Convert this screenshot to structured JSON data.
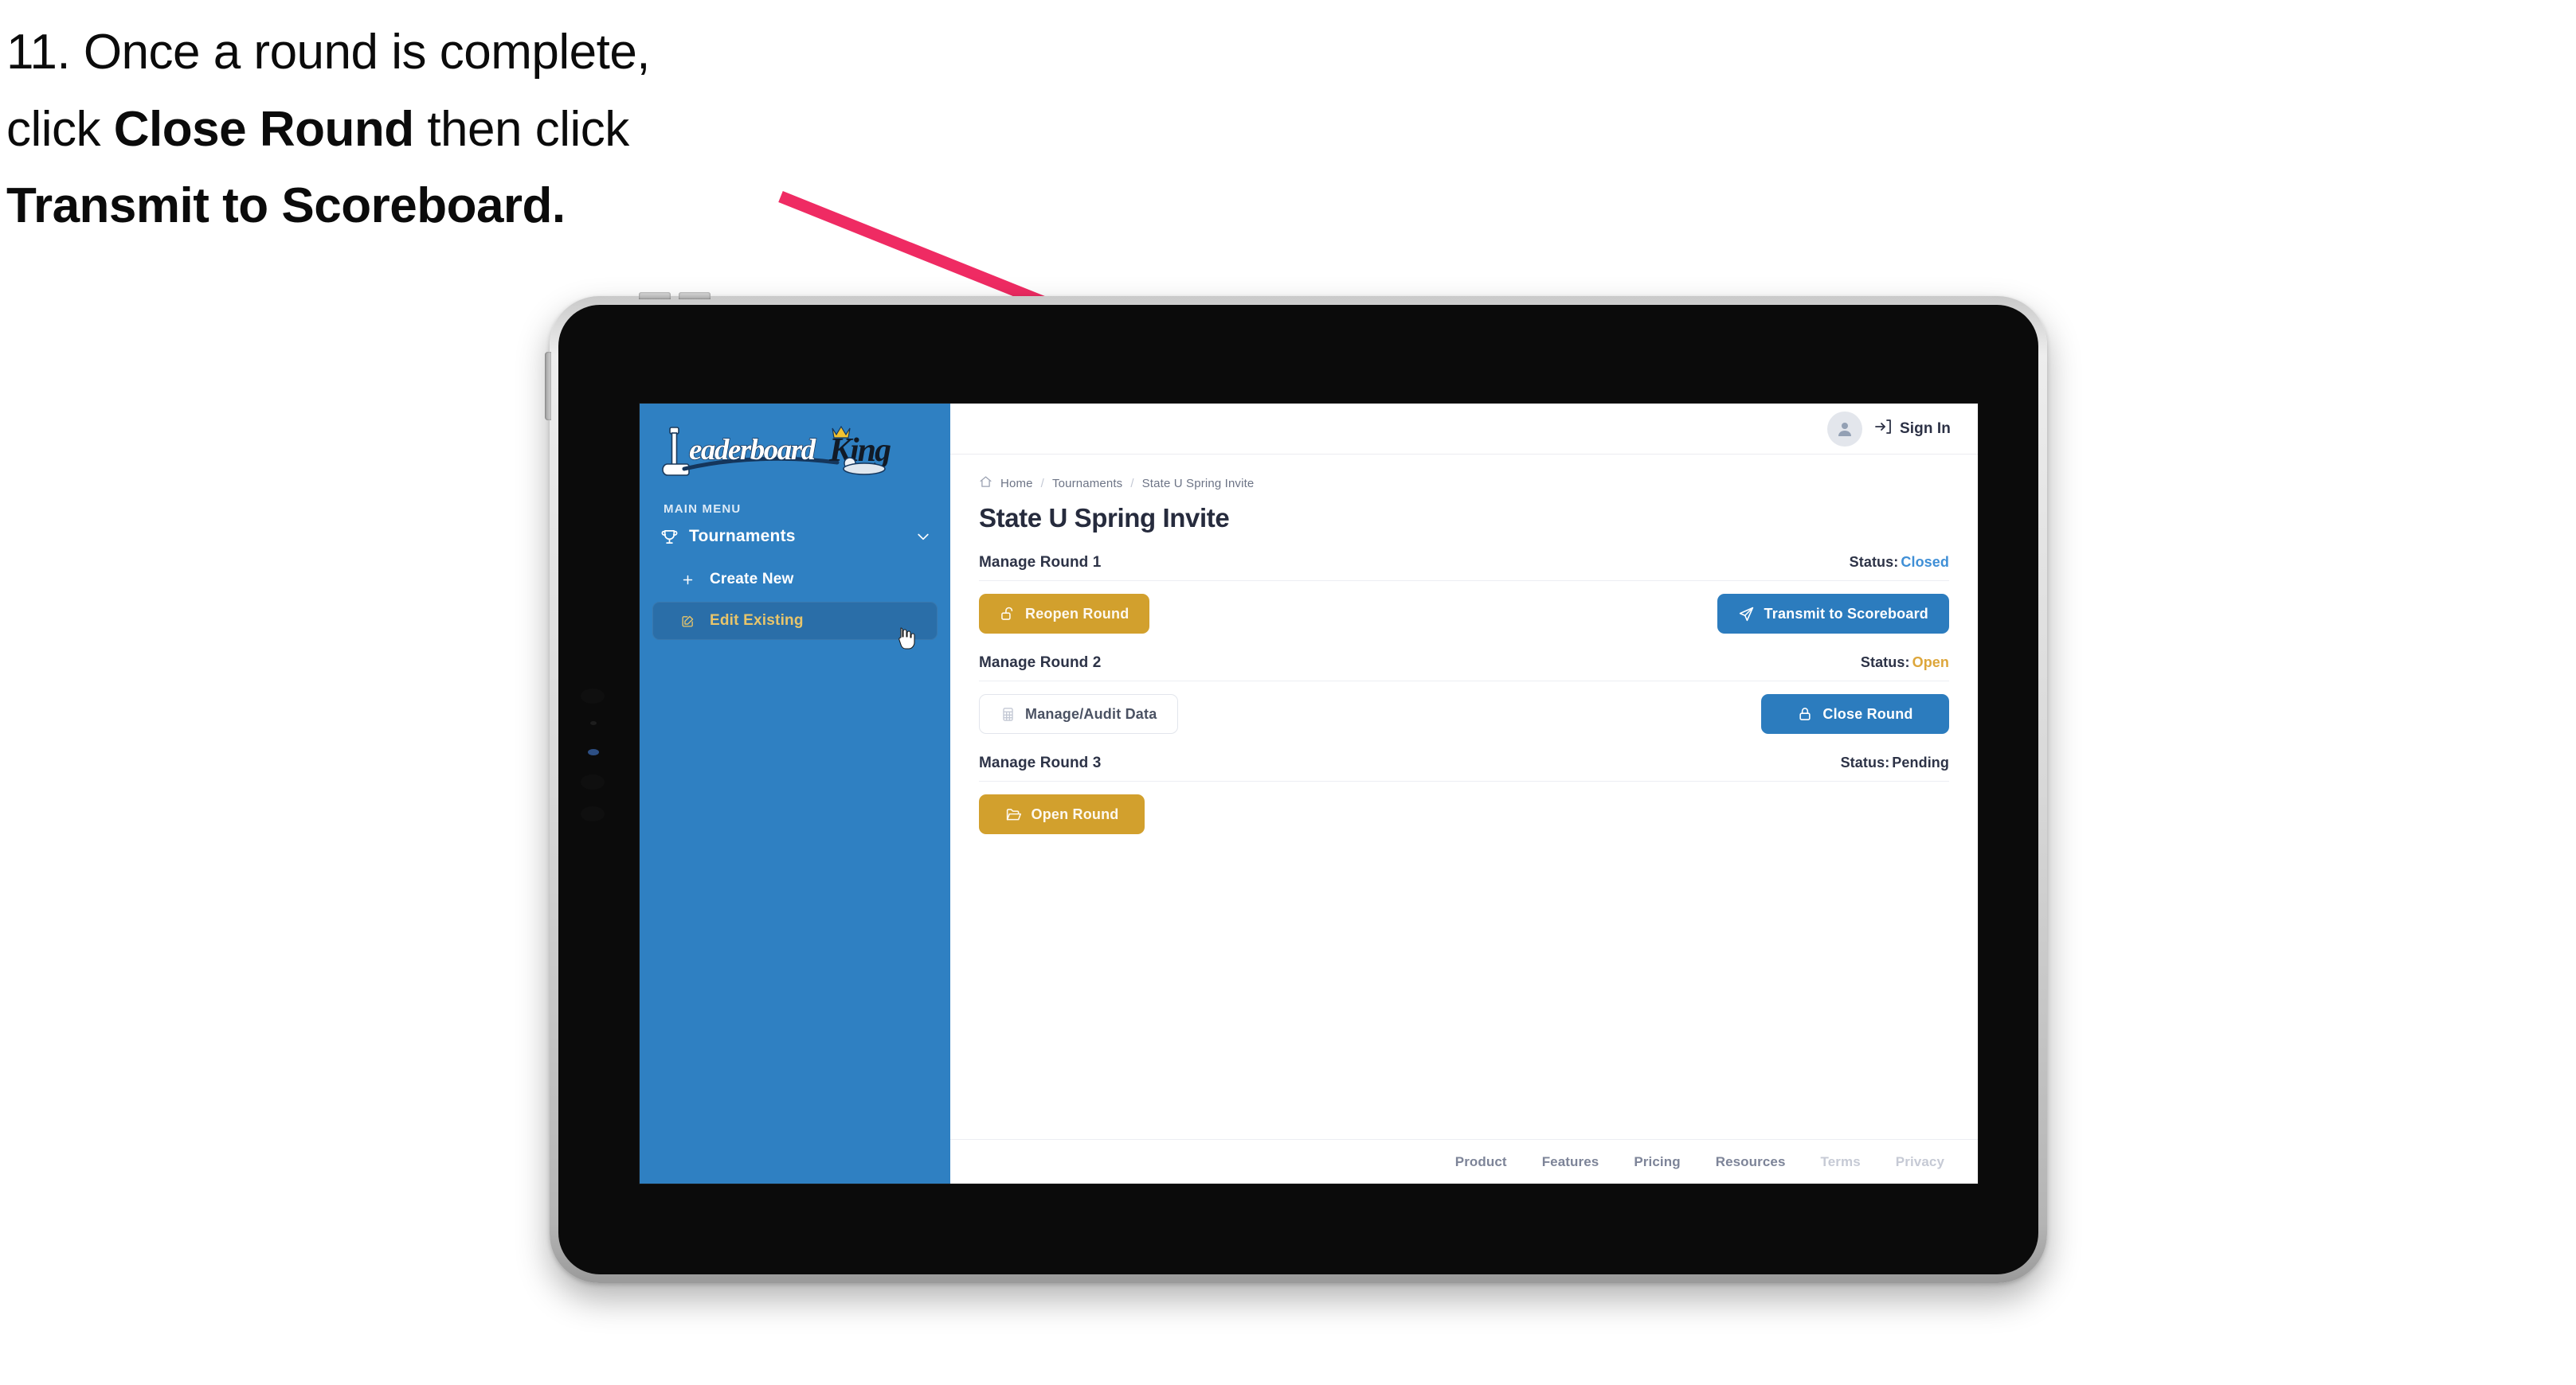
{
  "caption": {
    "line1_prefix": "11. Once a round is complete,",
    "line2_prefix": "click ",
    "line2_bold": "Close Round",
    "line2_suffix": " then click",
    "line3_bold": "Transmit to Scoreboard."
  },
  "annotation": {
    "arrow_color": "#ef2b63",
    "points_to": "Transmit to Scoreboard"
  },
  "sidebar": {
    "logo_text_primary": "Leaderboard",
    "logo_text_secondary": "King",
    "section_label": "MAIN MENU",
    "nav": {
      "label": "Tournaments",
      "icon": "trophy-icon",
      "chevron": "chevron-down-icon"
    },
    "sub_items": [
      {
        "label": "Create New",
        "icon": "plus-icon",
        "active": false
      },
      {
        "label": "Edit Existing",
        "icon": "edit-square-icon",
        "active": true
      }
    ],
    "bg_color": "#2f80c2",
    "active_bg_color": "#2a6ea8",
    "active_text_color": "#e8c56b"
  },
  "topbar": {
    "avatar_icon": "user-icon",
    "signin_icon": "login-arrow-icon",
    "signin_label": "Sign In"
  },
  "breadcrumb": {
    "home_icon": "home-icon",
    "items": [
      "Home",
      "Tournaments",
      "State U Spring Invite"
    ],
    "separator": "/"
  },
  "page": {
    "title": "State U Spring Invite"
  },
  "rounds": [
    {
      "title": "Manage Round 1",
      "status_label": "Status:",
      "status_value": "Closed",
      "status_class": "st-closed",
      "left_button": {
        "label": "Reopen Round",
        "icon": "unlock-icon",
        "style": "gold"
      },
      "right_button": {
        "label": "Transmit to Scoreboard",
        "icon": "paper-plane-icon",
        "style": "blue"
      }
    },
    {
      "title": "Manage Round 2",
      "status_label": "Status:",
      "status_value": "Open",
      "status_class": "st-open",
      "left_button": {
        "label": "Manage/Audit Data",
        "icon": "table-grid-icon",
        "style": "ghost"
      },
      "right_button": {
        "label": "Close Round",
        "icon": "lock-icon",
        "style": "blue"
      }
    },
    {
      "title": "Manage Round 3",
      "status_label": "Status:",
      "status_value": "Pending",
      "status_class": "st-pending",
      "left_button": {
        "label": "Open Round",
        "icon": "open-folder-icon",
        "style": "gold"
      },
      "right_button": null
    }
  ],
  "footer": {
    "links": [
      {
        "label": "Product",
        "dim": false
      },
      {
        "label": "Features",
        "dim": false
      },
      {
        "label": "Pricing",
        "dim": false
      },
      {
        "label": "Resources",
        "dim": false
      },
      {
        "label": "Terms",
        "dim": true
      },
      {
        "label": "Privacy",
        "dim": true
      }
    ]
  },
  "colors": {
    "gold": "#d2a02d",
    "blue": "#2c7cbe",
    "sidebar_blue": "#2f80c2",
    "status_open": "#dda63a",
    "status_closed": "#3f8fd6",
    "arrow_pink": "#ef2b63"
  }
}
